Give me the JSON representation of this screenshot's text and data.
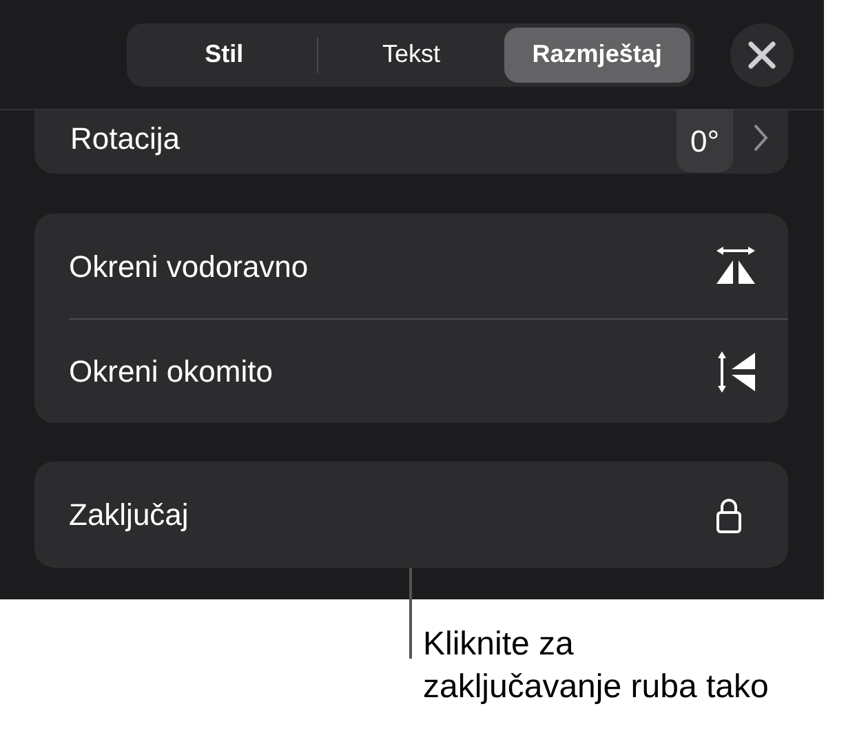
{
  "tabs": [
    {
      "label": "Stil",
      "selected": false
    },
    {
      "label": "Tekst",
      "selected": false
    },
    {
      "label": "Razmještaj",
      "selected": true
    }
  ],
  "rotation": {
    "label": "Rotacija",
    "value": "0°"
  },
  "flip_rows": [
    {
      "label": "Okreni vodoravno",
      "kind": "horizontal"
    },
    {
      "label": "Okreni okomito",
      "kind": "vertical"
    }
  ],
  "lock": {
    "label": "Zaključaj"
  },
  "callout": {
    "lines": [
      "Kliknite za",
      "zaključavanje ruba tako"
    ]
  }
}
